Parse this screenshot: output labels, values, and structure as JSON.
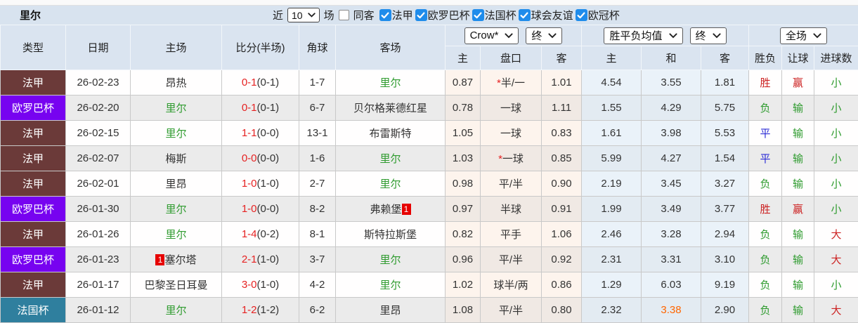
{
  "page": {
    "team": "里尔",
    "filter_bar": {
      "near_label": "近",
      "count_value": "10",
      "count_suffix": "场",
      "same_away_label": "同客",
      "same_away_checked": false,
      "league_filters": [
        {
          "label": "法甲",
          "checked": true
        },
        {
          "label": "欧罗巴杯",
          "checked": true
        },
        {
          "label": "法国杯",
          "checked": true
        },
        {
          "label": "球会友谊",
          "checked": true
        },
        {
          "label": "欧冠杯",
          "checked": true
        }
      ]
    },
    "controls": {
      "bookmaker": "Crow*",
      "bookmaker_time": "终",
      "average": "胜平负均值",
      "average_time": "终",
      "scope": "全场"
    }
  },
  "table": {
    "columns": [
      "类型",
      "日期",
      "主场",
      "比分(半场)",
      "角球",
      "客场",
      "主",
      "盘口",
      "客",
      "主",
      "和",
      "客",
      "胜负",
      "让球",
      "进球数"
    ],
    "league_colors": {
      "法甲": "#6b3a39",
      "欧罗巴杯": "#7703f0",
      "法国杯": "#2f7f9e"
    },
    "colors": {
      "red": "#cc2222",
      "green": "#2e9b2e",
      "blue": "#2b2bd5",
      "score_red": "#e62222",
      "orange": "#ff6600",
      "team_green": "#2e9b2e",
      "checkbox_blue": "#1f8ceb"
    },
    "rows": [
      {
        "league": "法甲",
        "date": "26-02-23",
        "home": "昂热",
        "home_green": false,
        "score": "0-1",
        "half": "(0-1)",
        "corner": "1-7",
        "away": "里尔",
        "away_green": true,
        "odds_home": "0.87",
        "handicap_star": true,
        "handicap": "半/一",
        "odds_away": "1.01",
        "avg_home": "4.54",
        "avg_draw": "3.55",
        "avg_away": "1.81",
        "result": "胜",
        "result_color": "red",
        "handicap_result": "赢",
        "handicap_result_color": "red",
        "goals": "小",
        "goals_color": "green"
      },
      {
        "league": "欧罗巴杯",
        "date": "26-02-20",
        "home": "里尔",
        "home_green": true,
        "score": "0-1",
        "half": "(0-1)",
        "corner": "6-7",
        "away": "贝尔格莱德红星",
        "away_green": false,
        "odds_home": "0.78",
        "handicap_star": false,
        "handicap": "一球",
        "odds_away": "1.11",
        "avg_home": "1.55",
        "avg_draw": "4.29",
        "avg_away": "5.75",
        "result": "负",
        "result_color": "green",
        "handicap_result": "输",
        "handicap_result_color": "green",
        "goals": "小",
        "goals_color": "green"
      },
      {
        "league": "法甲",
        "date": "26-02-15",
        "home": "里尔",
        "home_green": true,
        "score": "1-1",
        "half": "(0-0)",
        "corner": "13-1",
        "away": "布雷斯特",
        "away_green": false,
        "odds_home": "1.05",
        "handicap_star": false,
        "handicap": "一球",
        "odds_away": "0.83",
        "avg_home": "1.61",
        "avg_draw": "3.98",
        "avg_away": "5.53",
        "result": "平",
        "result_color": "blue",
        "handicap_result": "输",
        "handicap_result_color": "green",
        "goals": "小",
        "goals_color": "green"
      },
      {
        "league": "法甲",
        "date": "26-02-07",
        "home": "梅斯",
        "home_green": false,
        "score": "0-0",
        "half": "(0-0)",
        "corner": "1-6",
        "away": "里尔",
        "away_green": true,
        "odds_home": "1.03",
        "handicap_star": true,
        "handicap": "一球",
        "odds_away": "0.85",
        "avg_home": "5.99",
        "avg_draw": "4.27",
        "avg_away": "1.54",
        "result": "平",
        "result_color": "blue",
        "handicap_result": "输",
        "handicap_result_color": "green",
        "goals": "小",
        "goals_color": "green"
      },
      {
        "league": "法甲",
        "date": "26-02-01",
        "home": "里昂",
        "home_green": false,
        "score": "1-0",
        "half": "(1-0)",
        "corner": "2-7",
        "away": "里尔",
        "away_green": true,
        "odds_home": "0.98",
        "handicap_star": false,
        "handicap": "平/半",
        "odds_away": "0.90",
        "avg_home": "2.19",
        "avg_draw": "3.45",
        "avg_away": "3.27",
        "result": "负",
        "result_color": "green",
        "handicap_result": "输",
        "handicap_result_color": "green",
        "goals": "小",
        "goals_color": "green"
      },
      {
        "league": "欧罗巴杯",
        "date": "26-01-30",
        "home": "里尔",
        "home_green": true,
        "score": "1-0",
        "half": "(0-0)",
        "corner": "8-2",
        "away": "弗赖堡",
        "away_green": false,
        "away_badge": "1",
        "odds_home": "0.97",
        "handicap_star": false,
        "handicap": "半球",
        "odds_away": "0.91",
        "avg_home": "1.99",
        "avg_draw": "3.49",
        "avg_away": "3.77",
        "result": "胜",
        "result_color": "red",
        "handicap_result": "赢",
        "handicap_result_color": "red",
        "goals": "小",
        "goals_color": "green"
      },
      {
        "league": "法甲",
        "date": "26-01-26",
        "home": "里尔",
        "home_green": true,
        "score": "1-4",
        "half": "(0-2)",
        "corner": "8-1",
        "away": "斯特拉斯堡",
        "away_green": false,
        "odds_home": "0.82",
        "handicap_star": false,
        "handicap": "平手",
        "odds_away": "1.06",
        "avg_home": "2.46",
        "avg_draw": "3.28",
        "avg_away": "2.94",
        "result": "负",
        "result_color": "green",
        "handicap_result": "输",
        "handicap_result_color": "green",
        "goals": "大",
        "goals_color": "red"
      },
      {
        "league": "欧罗巴杯",
        "date": "26-01-23",
        "home": "塞尔塔",
        "home_green": false,
        "home_badge": "1",
        "score": "2-1",
        "half": "(1-0)",
        "corner": "3-7",
        "away": "里尔",
        "away_green": true,
        "odds_home": "0.96",
        "handicap_star": false,
        "handicap": "平/半",
        "odds_away": "0.92",
        "avg_home": "2.31",
        "avg_draw": "3.31",
        "avg_away": "3.10",
        "result": "负",
        "result_color": "green",
        "handicap_result": "输",
        "handicap_result_color": "green",
        "goals": "大",
        "goals_color": "red"
      },
      {
        "league": "法甲",
        "date": "26-01-17",
        "home": "巴黎圣日耳曼",
        "home_green": false,
        "score": "3-0",
        "half": "(1-0)",
        "corner": "4-2",
        "away": "里尔",
        "away_green": true,
        "odds_home": "1.02",
        "handicap_star": false,
        "handicap": "球半/两",
        "odds_away": "0.86",
        "avg_home": "1.29",
        "avg_draw": "6.03",
        "avg_away": "9.19",
        "result": "负",
        "result_color": "green",
        "handicap_result": "输",
        "handicap_result_color": "green",
        "goals": "小",
        "goals_color": "green"
      },
      {
        "league": "法国杯",
        "date": "26-01-12",
        "home": "里尔",
        "home_green": true,
        "score": "1-2",
        "half": "(1-2)",
        "corner": "6-2",
        "away": "里昂",
        "away_green": false,
        "odds_home": "1.08",
        "handicap_star": false,
        "handicap": "平/半",
        "odds_away": "0.80",
        "avg_home": "2.32",
        "avg_draw": "3.38",
        "avg_draw_orange": true,
        "avg_away": "2.90",
        "result": "负",
        "result_color": "green",
        "handicap_result": "输",
        "handicap_result_color": "green",
        "goals": "大",
        "goals_color": "red"
      }
    ]
  }
}
